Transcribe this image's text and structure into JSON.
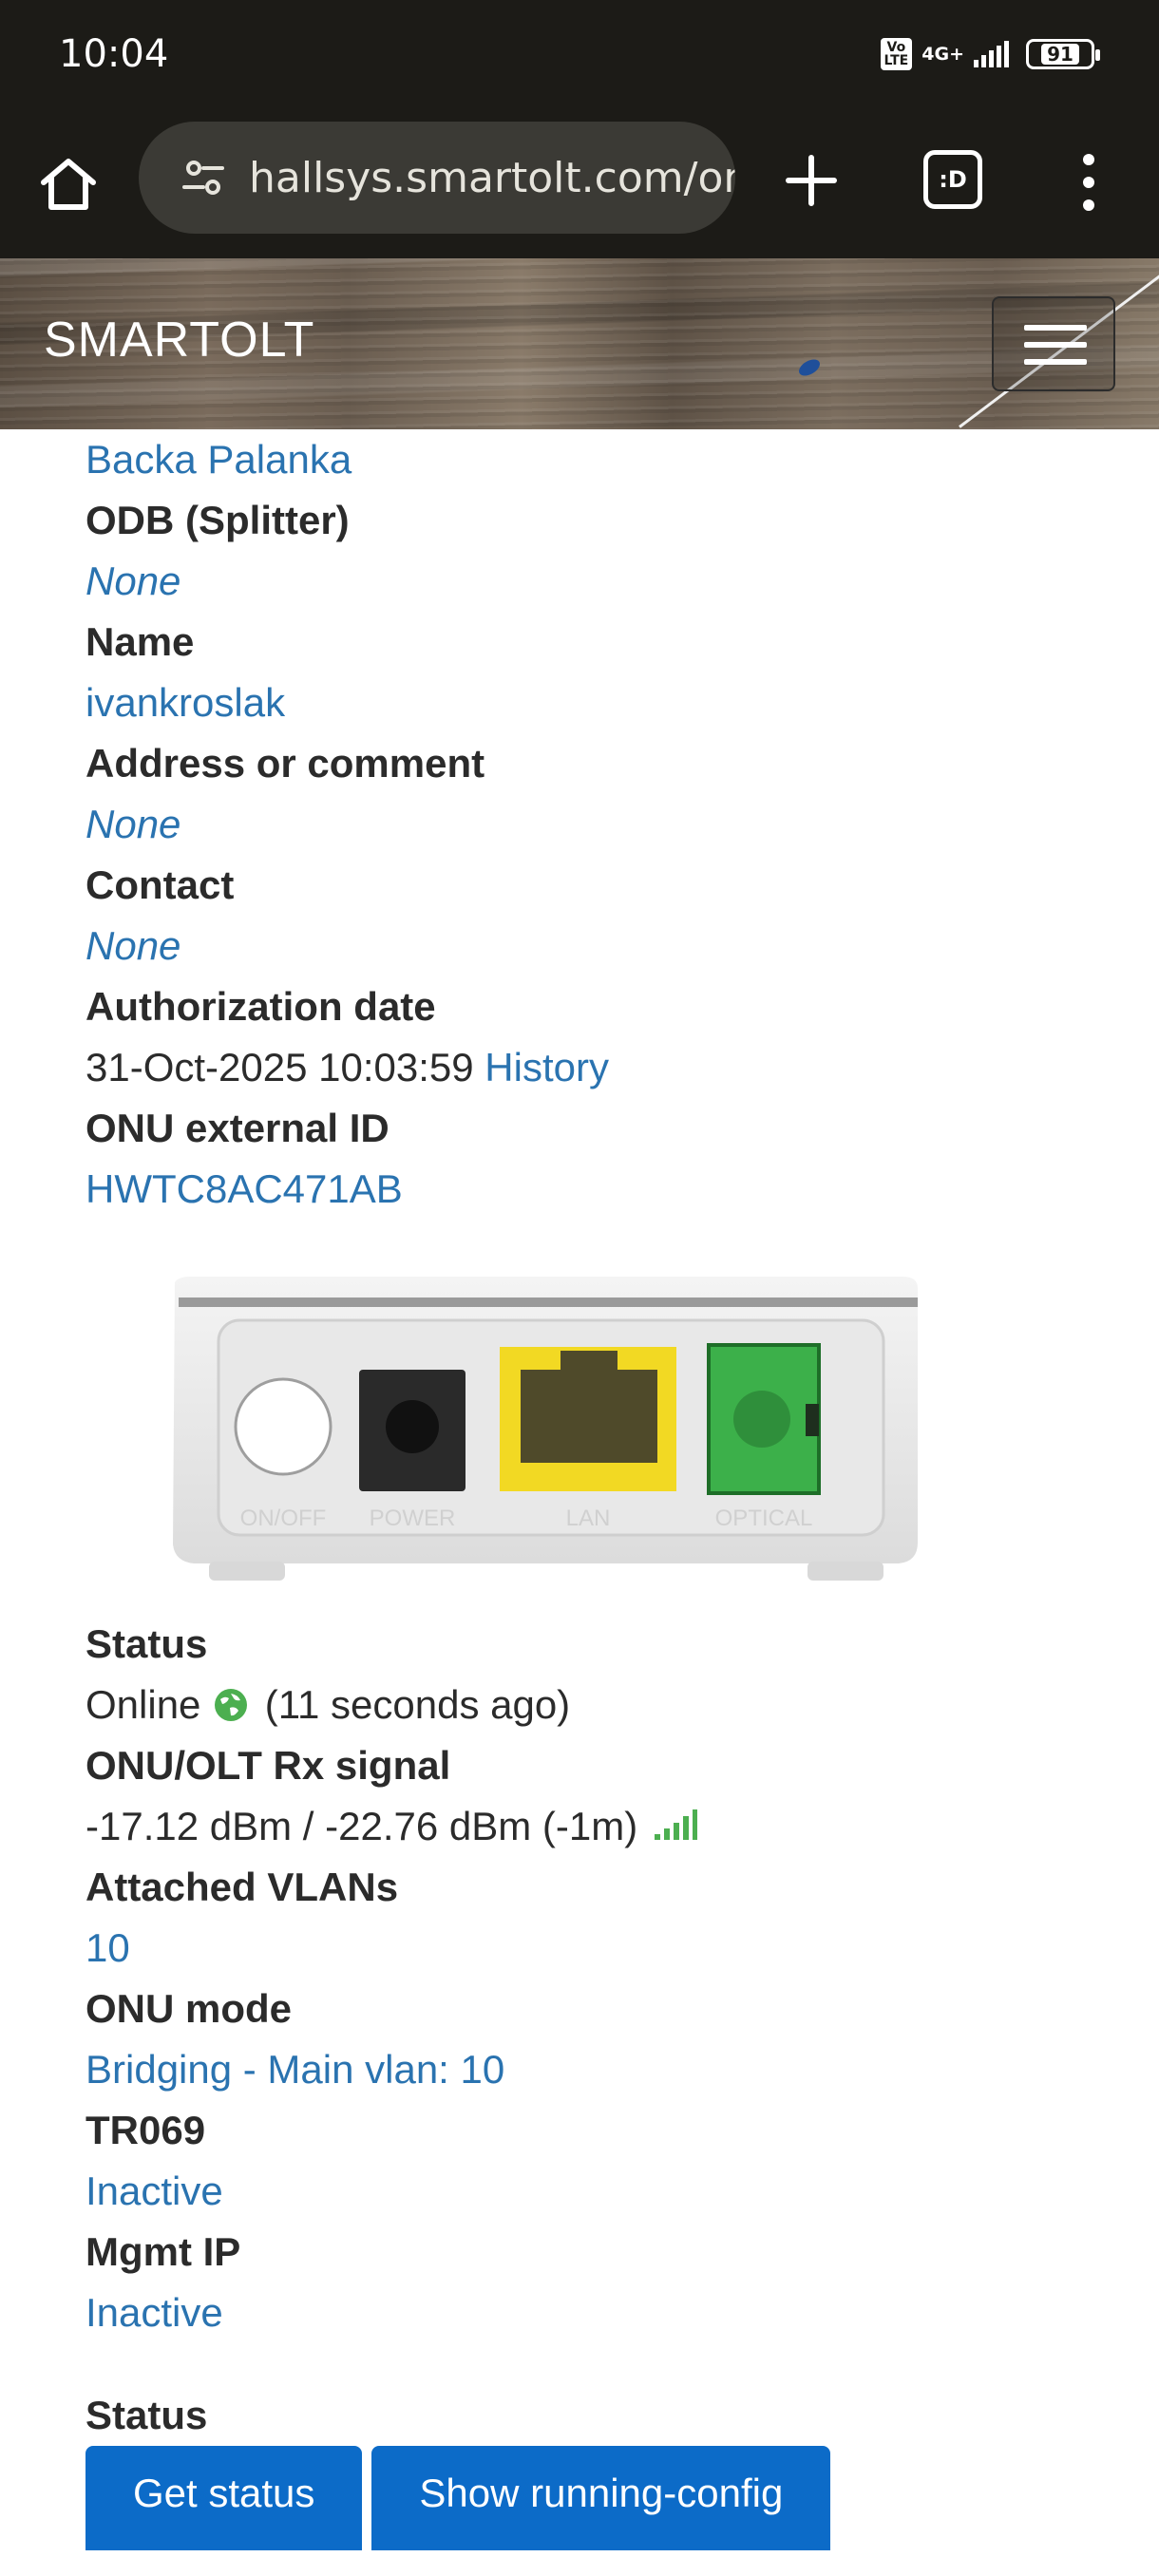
{
  "status_bar": {
    "time": "10:04",
    "volte_label": "Vo LTE",
    "network_label": "4G+",
    "battery": "91"
  },
  "browser": {
    "url": "hallsys.smartolt.com/on",
    "tab_count": ":D"
  },
  "site": {
    "brand": "SMARTOLT"
  },
  "details": {
    "zone_value": "Backa Palanka",
    "odb_label": "ODB (Splitter)",
    "odb_value": "None",
    "name_label": "Name",
    "name_value": "ivankroslak",
    "address_label": "Address or comment",
    "address_value": "None",
    "contact_label": "Contact",
    "contact_value": "None",
    "auth_label": "Authorization date",
    "auth_value": "31-Oct-2025 10:03:59",
    "history_link": "History",
    "ext_id_label": "ONU external ID",
    "ext_id_value": "HWTC8AC471AB"
  },
  "device_ports": {
    "onoff": "ON/OFF",
    "power": "POWER",
    "lan": "LAN",
    "optical": "OPTICAL"
  },
  "status": {
    "status_label": "Status",
    "status_value": "Online",
    "status_ago": "(11 seconds ago)",
    "rx_label": "ONU/OLT Rx signal",
    "rx_value": "-17.12 dBm / -22.76 dBm (-1m)",
    "vlans_label": "Attached VLANs",
    "vlans_value": "10",
    "mode_label": "ONU mode",
    "mode_value": "Bridging - Main vlan: 10",
    "tr069_label": "TR069",
    "tr069_value": "Inactive",
    "mgmt_label": "Mgmt IP",
    "mgmt_value": "Inactive"
  },
  "actions": {
    "section_label": "Status",
    "get_status": "Get status",
    "show_config": "Show running-config"
  },
  "colors": {
    "link": "#2a73b0",
    "button": "#0c6bc8",
    "online": "#4caf50",
    "lan_port": "#f2d923",
    "optical_port": "#3cb04a"
  }
}
